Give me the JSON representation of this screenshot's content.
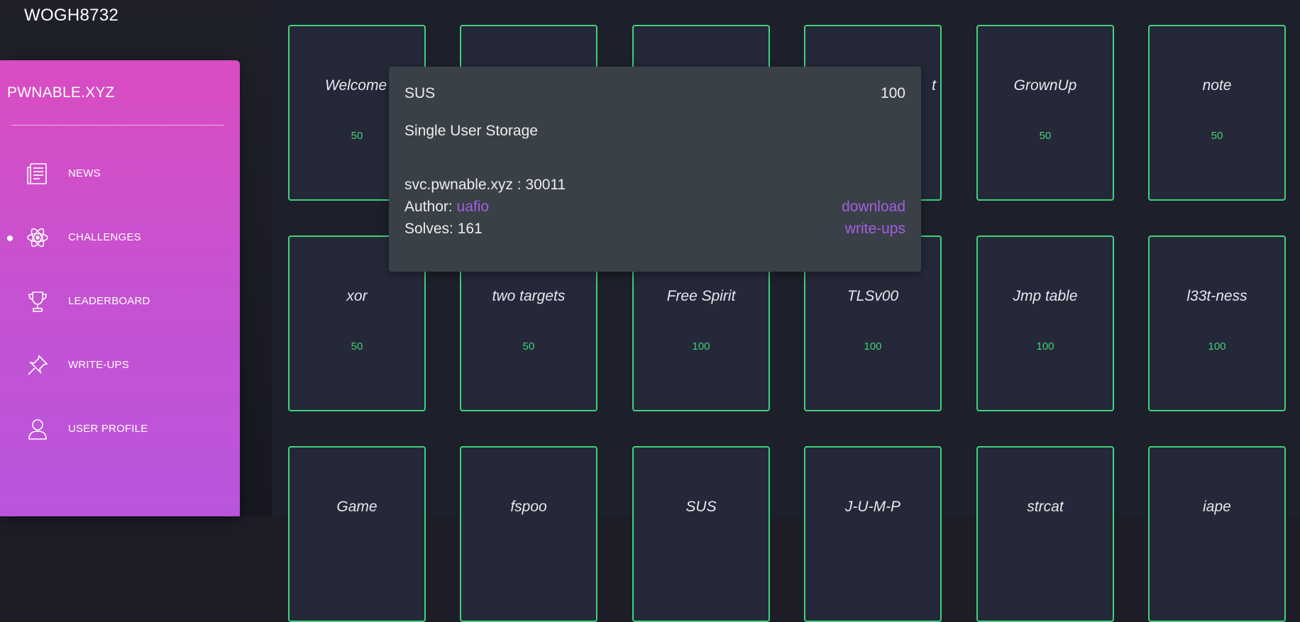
{
  "header": {
    "username": "WOGH8732"
  },
  "sidebar": {
    "brand": "PWNABLE.XYZ",
    "items": [
      {
        "label": "NEWS",
        "icon": "news-icon"
      },
      {
        "label": "CHALLENGES",
        "icon": "atom-icon",
        "active": true
      },
      {
        "label": "LEADERBOARD",
        "icon": "trophy-icon"
      },
      {
        "label": "WRITE-UPS",
        "icon": "pin-icon"
      },
      {
        "label": "USER PROFILE",
        "icon": "user-icon"
      }
    ]
  },
  "challenges": [
    {
      "title": "Welcome",
      "points": "50"
    },
    {
      "title": "",
      "points": ""
    },
    {
      "title": "",
      "points": ""
    },
    {
      "title": "t",
      "points": ""
    },
    {
      "title": "GrownUp",
      "points": "50"
    },
    {
      "title": "note",
      "points": "50"
    },
    {
      "title": "xor",
      "points": "50"
    },
    {
      "title": "two targets",
      "points": "50"
    },
    {
      "title": "Free Spirit",
      "points": "100"
    },
    {
      "title": "TLSv00",
      "points": "100"
    },
    {
      "title": "Jmp table",
      "points": "100"
    },
    {
      "title": "l33t-ness",
      "points": "100"
    },
    {
      "title": "Game",
      "points": ""
    },
    {
      "title": "fspoo",
      "points": ""
    },
    {
      "title": "SUS",
      "points": ""
    },
    {
      "title": "J-U-M-P",
      "points": ""
    },
    {
      "title": "strcat",
      "points": ""
    },
    {
      "title": "iape",
      "points": ""
    }
  ],
  "tooltip": {
    "name": "SUS",
    "points": "100",
    "description": "Single User Storage",
    "service": "svc.pwnable.xyz : 30011",
    "author_label": "Author: ",
    "author": "uafio",
    "solves": "Solves: 161",
    "download": "download",
    "writeups": "write-ups"
  },
  "colors": {
    "accent_green": "#3fd27a",
    "link_purple": "#a35fe0",
    "sidebar_top": "#d94cc2",
    "sidebar_bottom": "#b955dd"
  }
}
